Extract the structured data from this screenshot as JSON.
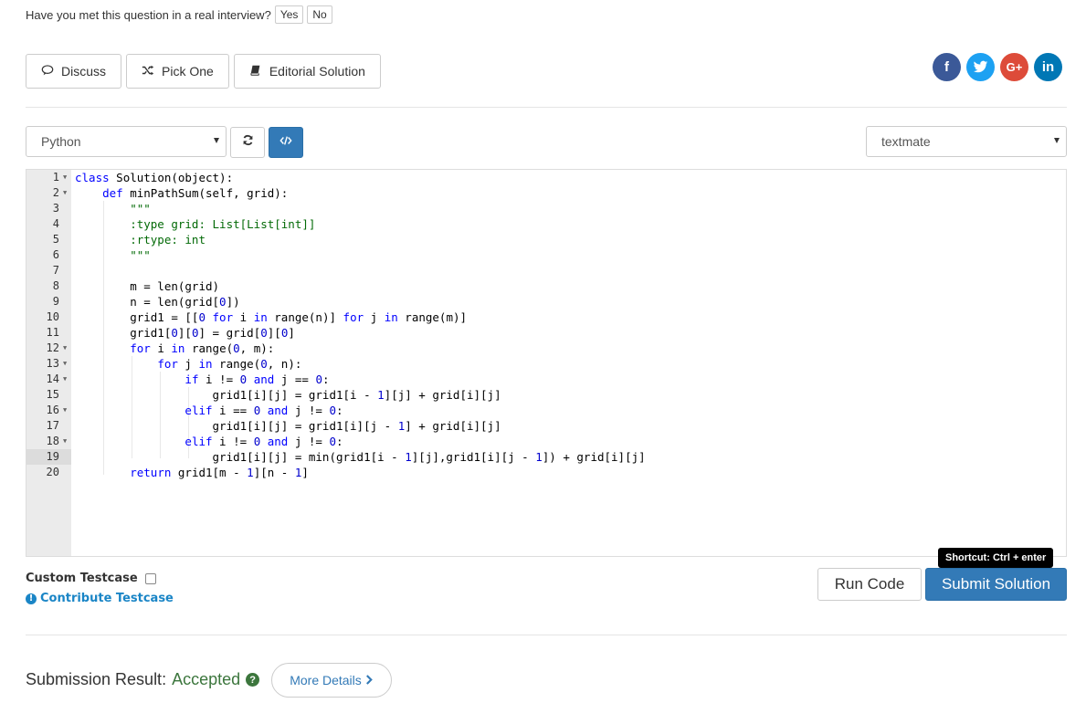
{
  "question_bar": {
    "text": "Have you met this question in a real interview?",
    "yes_label": "Yes",
    "no_label": "No"
  },
  "actions": {
    "discuss_label": "Discuss",
    "pick_one_label": "Pick One",
    "editorial_label": "Editorial Solution"
  },
  "social": {
    "facebook": "f",
    "google": "G+",
    "linkedin": "in"
  },
  "editor_toolbar": {
    "language": "Python",
    "theme": "textmate"
  },
  "colors": {
    "primary": "#337ab7",
    "accepted": "#3c763d",
    "link": "#1a85c6",
    "facebook": "#3b5998",
    "twitter": "#1da1f2",
    "google": "#dd4b39",
    "linkedin": "#0077b5"
  },
  "bottom": {
    "custom_testcase_label": "Custom Testcase",
    "contribute_label": "Contribute Testcase",
    "run_label": "Run Code",
    "submit_label": "Submit Solution",
    "tooltip": "Shortcut: Ctrl + enter"
  },
  "result": {
    "label": "Submission Result:",
    "status": "Accepted",
    "more_details_label": "More Details"
  }
}
